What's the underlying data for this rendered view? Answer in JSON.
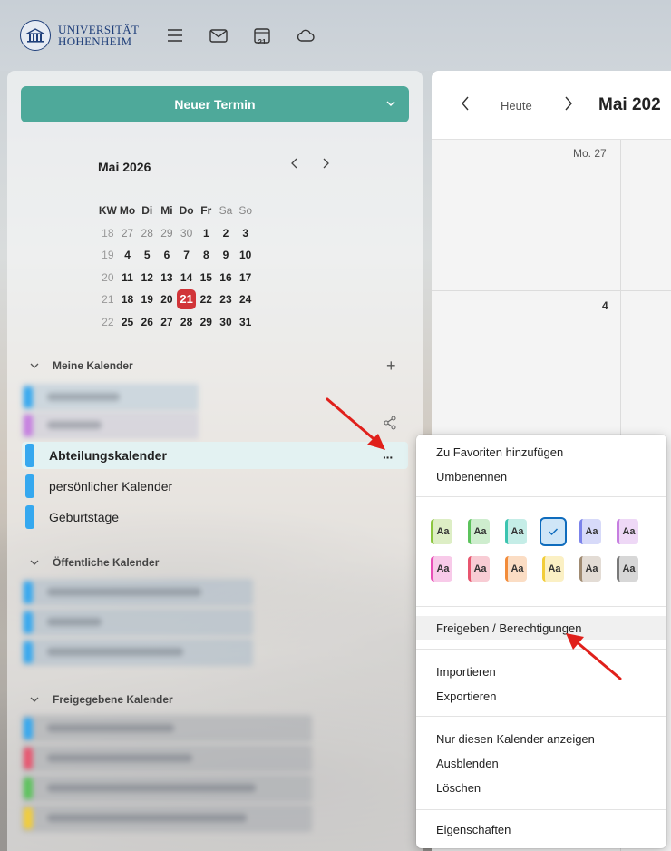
{
  "header": {
    "logo_line1": "UNIVERSITÄT",
    "logo_line2": "HOHENHEIM",
    "calendar_icon_day": "21"
  },
  "sidebar": {
    "new_event_label": "Neuer Termin",
    "minicalendar": {
      "title": "Mai 2026",
      "headers": [
        "KW",
        "Mo",
        "Di",
        "Mi",
        "Do",
        "Fr",
        "Sa",
        "So"
      ],
      "weeks": [
        {
          "kw": "18",
          "days": [
            "27",
            "28",
            "29",
            "30",
            "1",
            "2",
            "3"
          ]
        },
        {
          "kw": "19",
          "days": [
            "4",
            "5",
            "6",
            "7",
            "8",
            "9",
            "10"
          ]
        },
        {
          "kw": "20",
          "days": [
            "11",
            "12",
            "13",
            "14",
            "15",
            "16",
            "17"
          ]
        },
        {
          "kw": "21",
          "days": [
            "18",
            "19",
            "20",
            "21",
            "22",
            "23",
            "24"
          ]
        },
        {
          "kw": "22",
          "days": [
            "25",
            "26",
            "27",
            "28",
            "29",
            "30",
            "31"
          ]
        }
      ],
      "today": "21"
    },
    "sections": {
      "my": "Meine Kalender",
      "public": "Öffentliche Kalender",
      "shared": "Freigegebene Kalender"
    },
    "my_calendars": [
      {
        "name": "Abteilungskalender",
        "color": "#35a8ef"
      },
      {
        "name": "persönlicher Kalender",
        "color": "#35a8ef"
      },
      {
        "name": "Geburtstage",
        "color": "#35a8ef"
      }
    ]
  },
  "main": {
    "today_label": "Heute",
    "title": "Mai 202",
    "day_label_1": "Mo. 27",
    "day_label_2": "4"
  },
  "context_menu": {
    "add_favorite": "Zu Favoriten hinzufügen",
    "rename": "Umbenennen",
    "swatch_label": "Aa",
    "share_permissions": "Freigeben / Berechtigungen",
    "import": "Importieren",
    "export": "Exportieren",
    "only_this": "Nur diesen Kalender anzeigen",
    "hide": "Ausblenden",
    "delete": "Löschen",
    "properties": "Eigenschaften",
    "colors_row1": [
      "#8cc63f",
      "#5cc35c",
      "#3cc4b0",
      "#35a8ef",
      "#7b83eb",
      "#c67ee0"
    ],
    "colors_row2": [
      "#e84fb6",
      "#e8566f",
      "#f28c3a",
      "#f2cd3a",
      "#a08b72",
      "#7a7a7a"
    ]
  }
}
